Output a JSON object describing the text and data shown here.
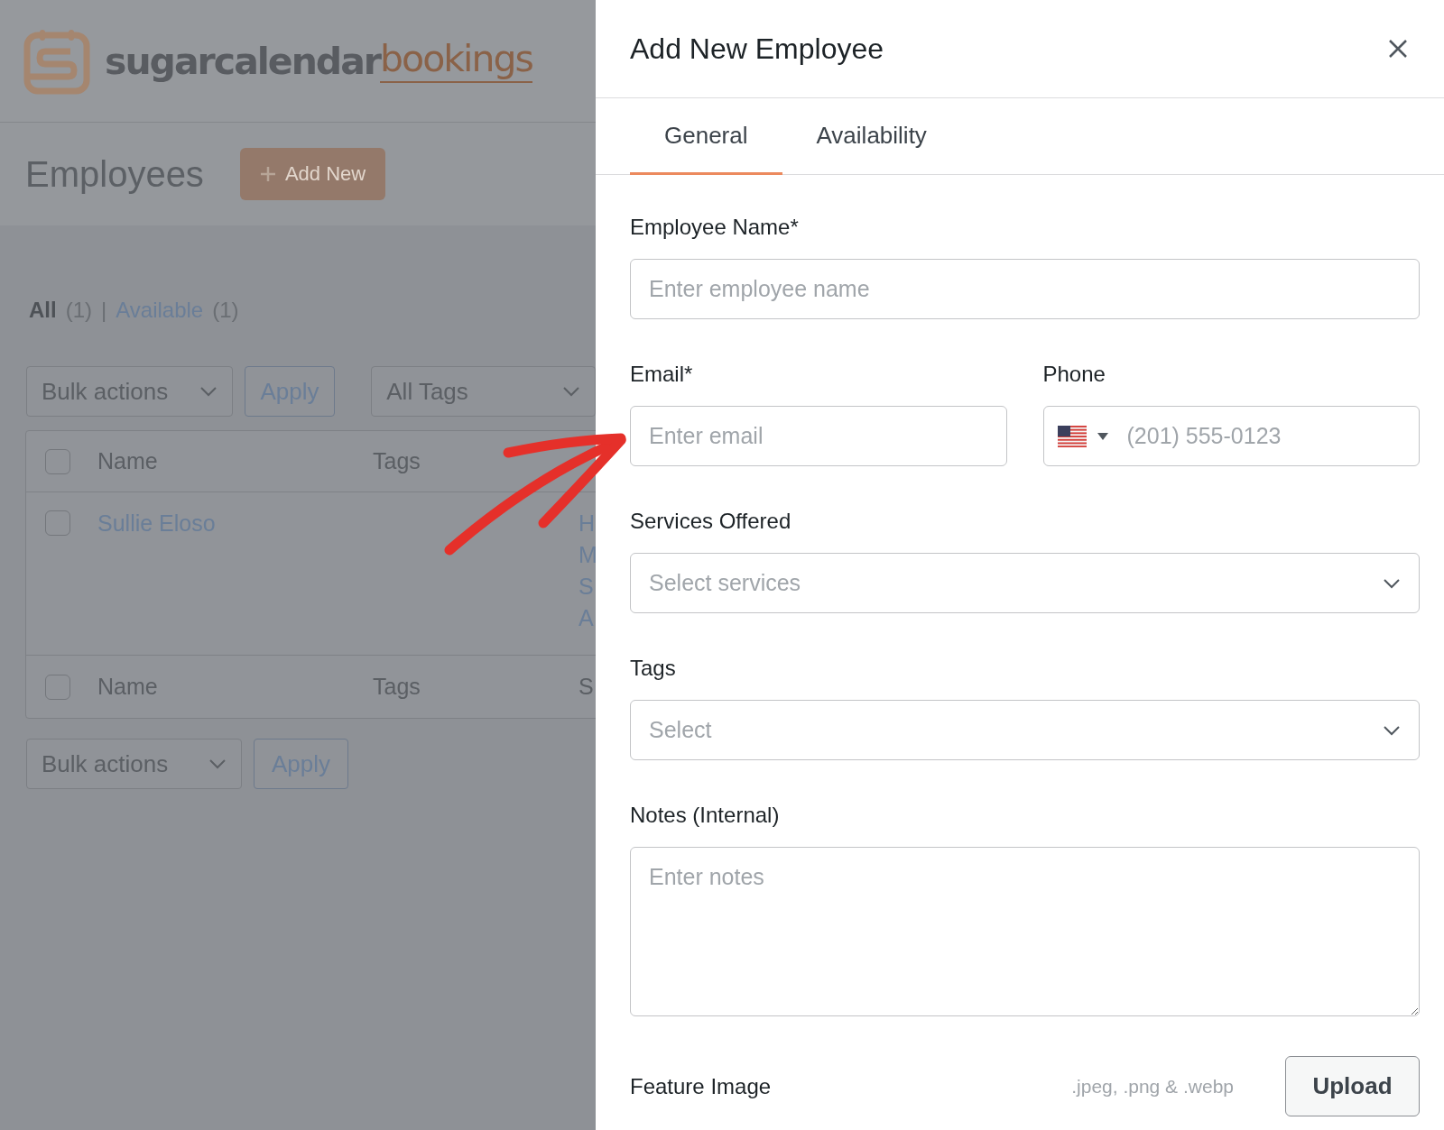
{
  "background_page": {
    "logo": {
      "name": "sugarcalendar",
      "suffix": "bookings"
    },
    "heading": "Employees",
    "add_button": "Add New",
    "filters": [
      {
        "label": "All",
        "count": "(1)",
        "selected": true
      },
      {
        "label": "Available",
        "count": "(1)",
        "selected": false
      }
    ],
    "filter_separator": "|",
    "top_actions": {
      "bulk": "Bulk actions",
      "apply": "Apply",
      "tags": "All Tags"
    },
    "table": {
      "header": {
        "checked": false,
        "columns": [
          "Name",
          "Tags"
        ]
      },
      "rows": [
        {
          "checked": false,
          "name": "Sullie Eloso",
          "column_3": [
            "H",
            "M",
            "S",
            "A"
          ]
        }
      ],
      "footer": {
        "checked": false,
        "columns": [
          "Name",
          "Tags",
          "S"
        ]
      }
    },
    "bottom_actions": {
      "bulk": "Bulk actions",
      "apply": "Apply"
    }
  },
  "panel": {
    "title": "Add New Employee",
    "tabs": [
      {
        "label": "General",
        "selected": true
      },
      {
        "label": "Availability",
        "selected": false
      }
    ],
    "fields": [
      {
        "kind": "text",
        "label": "Employee Name*",
        "placeholder": "Enter employee name"
      },
      {
        "kind": "pair",
        "items": [
          {
            "kind": "text",
            "label": "Email*",
            "placeholder": "Enter email"
          },
          {
            "kind": "phone",
            "label": "Phone",
            "placeholder": "(201) 555-0123"
          }
        ]
      },
      {
        "kind": "select",
        "label": "Services Offered",
        "placeholder": "Select services"
      },
      {
        "kind": "select",
        "label": "Tags",
        "placeholder": "Select"
      },
      {
        "kind": "textarea",
        "label": "Notes (Internal)",
        "placeholder": "Enter notes"
      }
    ],
    "feature_image": {
      "label": "Feature Image",
      "hint": ".jpeg, .png & .webp",
      "button": "Upload"
    }
  }
}
